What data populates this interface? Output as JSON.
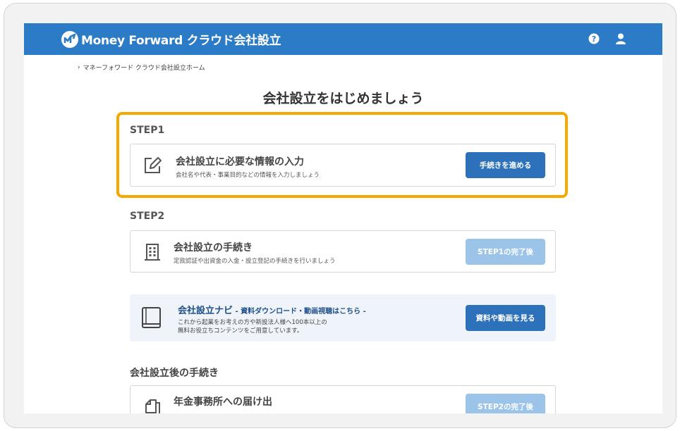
{
  "header": {
    "logo_text": "Money Forward クラウド会社設立",
    "help_icon": "question-circle-icon",
    "user_icon": "user-icon",
    "color": "#2c7bc6"
  },
  "breadcrumb": {
    "items": [
      "マネーフォワード クラウド会社設立ホーム"
    ]
  },
  "page_title": "会社設立をはじめましょう",
  "step1": {
    "label": "STEP1",
    "title": "会社設立に必要な情報の入力",
    "subtitle": "会社名や代表・事業目的などの情報を入力しましょう",
    "button": "手続きを進める",
    "icon": "edit-icon"
  },
  "step2": {
    "label": "STEP2",
    "title": "会社設立の手続き",
    "subtitle": "定款認証や出資金の入金・設立登記の手続きを行いましょう",
    "button": "STEP1の完了後",
    "icon": "building-icon"
  },
  "navi": {
    "title": "会社設立ナビ",
    "title_suffix": " - 資料ダウンロード・動画視聴はこちら -",
    "line1": "これから起業をお考えの方や新設法人様へ100本以上の",
    "line2": "無料お役立ちコンテンツをご用意しています。",
    "button": "資料や動画を見る",
    "icon": "book-icon"
  },
  "after": {
    "label": "会社設立後の手続き",
    "card_title": "年金事務所への届け出",
    "button": "STEP2の完了後",
    "icon": "documents-icon"
  },
  "colors": {
    "accent": "#2c71b9",
    "disabled": "#9cc3e8",
    "highlight": "#f5a800"
  }
}
